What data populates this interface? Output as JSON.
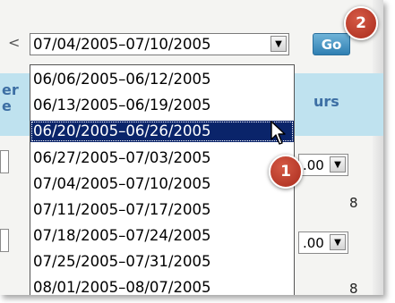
{
  "week_selector": {
    "current_value": "07/04/2005–07/10/2005",
    "go_label": "Go",
    "options": [
      {
        "label": "06/06/2005–06/12/2005",
        "selected": false
      },
      {
        "label": "06/13/2005–06/19/2005",
        "selected": false
      },
      {
        "label": "06/20/2005–06/26/2005",
        "selected": true
      },
      {
        "label": "06/27/2005–07/03/2005",
        "selected": false
      },
      {
        "label": "07/04/2005–07/10/2005",
        "selected": false
      },
      {
        "label": "07/11/2005–07/17/2005",
        "selected": false
      },
      {
        "label": "07/18/2005–07/24/2005",
        "selected": false
      },
      {
        "label": "07/25/2005–07/31/2005",
        "selected": false
      },
      {
        "label": "08/01/2005–08/07/2005",
        "selected": false
      }
    ]
  },
  "nav": {
    "prev_glyph": "<"
  },
  "table": {
    "header_left_line1": "er",
    "header_left_line2": "e",
    "header_right": "urs",
    "rows": [
      {
        "hours_select": ".00",
        "total": "8"
      },
      {
        "hours_select": ".00",
        "total": "8"
      }
    ]
  },
  "callouts": {
    "step1": "1",
    "step2": "2",
    "color": "#b8321f"
  },
  "colors": {
    "header_band": "#bfe2ef",
    "go_button": "#3f8fc0",
    "selection": "#0a246a"
  }
}
